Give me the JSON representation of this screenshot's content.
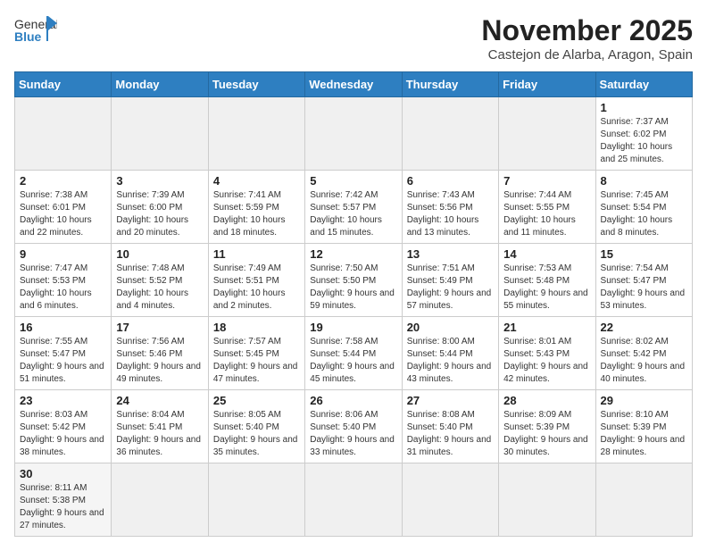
{
  "header": {
    "logo_general": "General",
    "logo_blue": "Blue",
    "month": "November 2025",
    "location": "Castejon de Alarba, Aragon, Spain"
  },
  "weekdays": [
    "Sunday",
    "Monday",
    "Tuesday",
    "Wednesday",
    "Thursday",
    "Friday",
    "Saturday"
  ],
  "weeks": [
    [
      {
        "day": "",
        "info": ""
      },
      {
        "day": "",
        "info": ""
      },
      {
        "day": "",
        "info": ""
      },
      {
        "day": "",
        "info": ""
      },
      {
        "day": "",
        "info": ""
      },
      {
        "day": "",
        "info": ""
      },
      {
        "day": "1",
        "info": "Sunrise: 7:37 AM\nSunset: 6:02 PM\nDaylight: 10 hours and 25 minutes."
      }
    ],
    [
      {
        "day": "2",
        "info": "Sunrise: 7:38 AM\nSunset: 6:01 PM\nDaylight: 10 hours and 22 minutes."
      },
      {
        "day": "3",
        "info": "Sunrise: 7:39 AM\nSunset: 6:00 PM\nDaylight: 10 hours and 20 minutes."
      },
      {
        "day": "4",
        "info": "Sunrise: 7:41 AM\nSunset: 5:59 PM\nDaylight: 10 hours and 18 minutes."
      },
      {
        "day": "5",
        "info": "Sunrise: 7:42 AM\nSunset: 5:57 PM\nDaylight: 10 hours and 15 minutes."
      },
      {
        "day": "6",
        "info": "Sunrise: 7:43 AM\nSunset: 5:56 PM\nDaylight: 10 hours and 13 minutes."
      },
      {
        "day": "7",
        "info": "Sunrise: 7:44 AM\nSunset: 5:55 PM\nDaylight: 10 hours and 11 minutes."
      },
      {
        "day": "8",
        "info": "Sunrise: 7:45 AM\nSunset: 5:54 PM\nDaylight: 10 hours and 8 minutes."
      }
    ],
    [
      {
        "day": "9",
        "info": "Sunrise: 7:47 AM\nSunset: 5:53 PM\nDaylight: 10 hours and 6 minutes."
      },
      {
        "day": "10",
        "info": "Sunrise: 7:48 AM\nSunset: 5:52 PM\nDaylight: 10 hours and 4 minutes."
      },
      {
        "day": "11",
        "info": "Sunrise: 7:49 AM\nSunset: 5:51 PM\nDaylight: 10 hours and 2 minutes."
      },
      {
        "day": "12",
        "info": "Sunrise: 7:50 AM\nSunset: 5:50 PM\nDaylight: 9 hours and 59 minutes."
      },
      {
        "day": "13",
        "info": "Sunrise: 7:51 AM\nSunset: 5:49 PM\nDaylight: 9 hours and 57 minutes."
      },
      {
        "day": "14",
        "info": "Sunrise: 7:53 AM\nSunset: 5:48 PM\nDaylight: 9 hours and 55 minutes."
      },
      {
        "day": "15",
        "info": "Sunrise: 7:54 AM\nSunset: 5:47 PM\nDaylight: 9 hours and 53 minutes."
      }
    ],
    [
      {
        "day": "16",
        "info": "Sunrise: 7:55 AM\nSunset: 5:47 PM\nDaylight: 9 hours and 51 minutes."
      },
      {
        "day": "17",
        "info": "Sunrise: 7:56 AM\nSunset: 5:46 PM\nDaylight: 9 hours and 49 minutes."
      },
      {
        "day": "18",
        "info": "Sunrise: 7:57 AM\nSunset: 5:45 PM\nDaylight: 9 hours and 47 minutes."
      },
      {
        "day": "19",
        "info": "Sunrise: 7:58 AM\nSunset: 5:44 PM\nDaylight: 9 hours and 45 minutes."
      },
      {
        "day": "20",
        "info": "Sunrise: 8:00 AM\nSunset: 5:44 PM\nDaylight: 9 hours and 43 minutes."
      },
      {
        "day": "21",
        "info": "Sunrise: 8:01 AM\nSunset: 5:43 PM\nDaylight: 9 hours and 42 minutes."
      },
      {
        "day": "22",
        "info": "Sunrise: 8:02 AM\nSunset: 5:42 PM\nDaylight: 9 hours and 40 minutes."
      }
    ],
    [
      {
        "day": "23",
        "info": "Sunrise: 8:03 AM\nSunset: 5:42 PM\nDaylight: 9 hours and 38 minutes."
      },
      {
        "day": "24",
        "info": "Sunrise: 8:04 AM\nSunset: 5:41 PM\nDaylight: 9 hours and 36 minutes."
      },
      {
        "day": "25",
        "info": "Sunrise: 8:05 AM\nSunset: 5:40 PM\nDaylight: 9 hours and 35 minutes."
      },
      {
        "day": "26",
        "info": "Sunrise: 8:06 AM\nSunset: 5:40 PM\nDaylight: 9 hours and 33 minutes."
      },
      {
        "day": "27",
        "info": "Sunrise: 8:08 AM\nSunset: 5:40 PM\nDaylight: 9 hours and 31 minutes."
      },
      {
        "day": "28",
        "info": "Sunrise: 8:09 AM\nSunset: 5:39 PM\nDaylight: 9 hours and 30 minutes."
      },
      {
        "day": "29",
        "info": "Sunrise: 8:10 AM\nSunset: 5:39 PM\nDaylight: 9 hours and 28 minutes."
      }
    ],
    [
      {
        "day": "30",
        "info": "Sunrise: 8:11 AM\nSunset: 5:38 PM\nDaylight: 9 hours and 27 minutes."
      },
      {
        "day": "",
        "info": ""
      },
      {
        "day": "",
        "info": ""
      },
      {
        "day": "",
        "info": ""
      },
      {
        "day": "",
        "info": ""
      },
      {
        "day": "",
        "info": ""
      },
      {
        "day": "",
        "info": ""
      }
    ]
  ]
}
